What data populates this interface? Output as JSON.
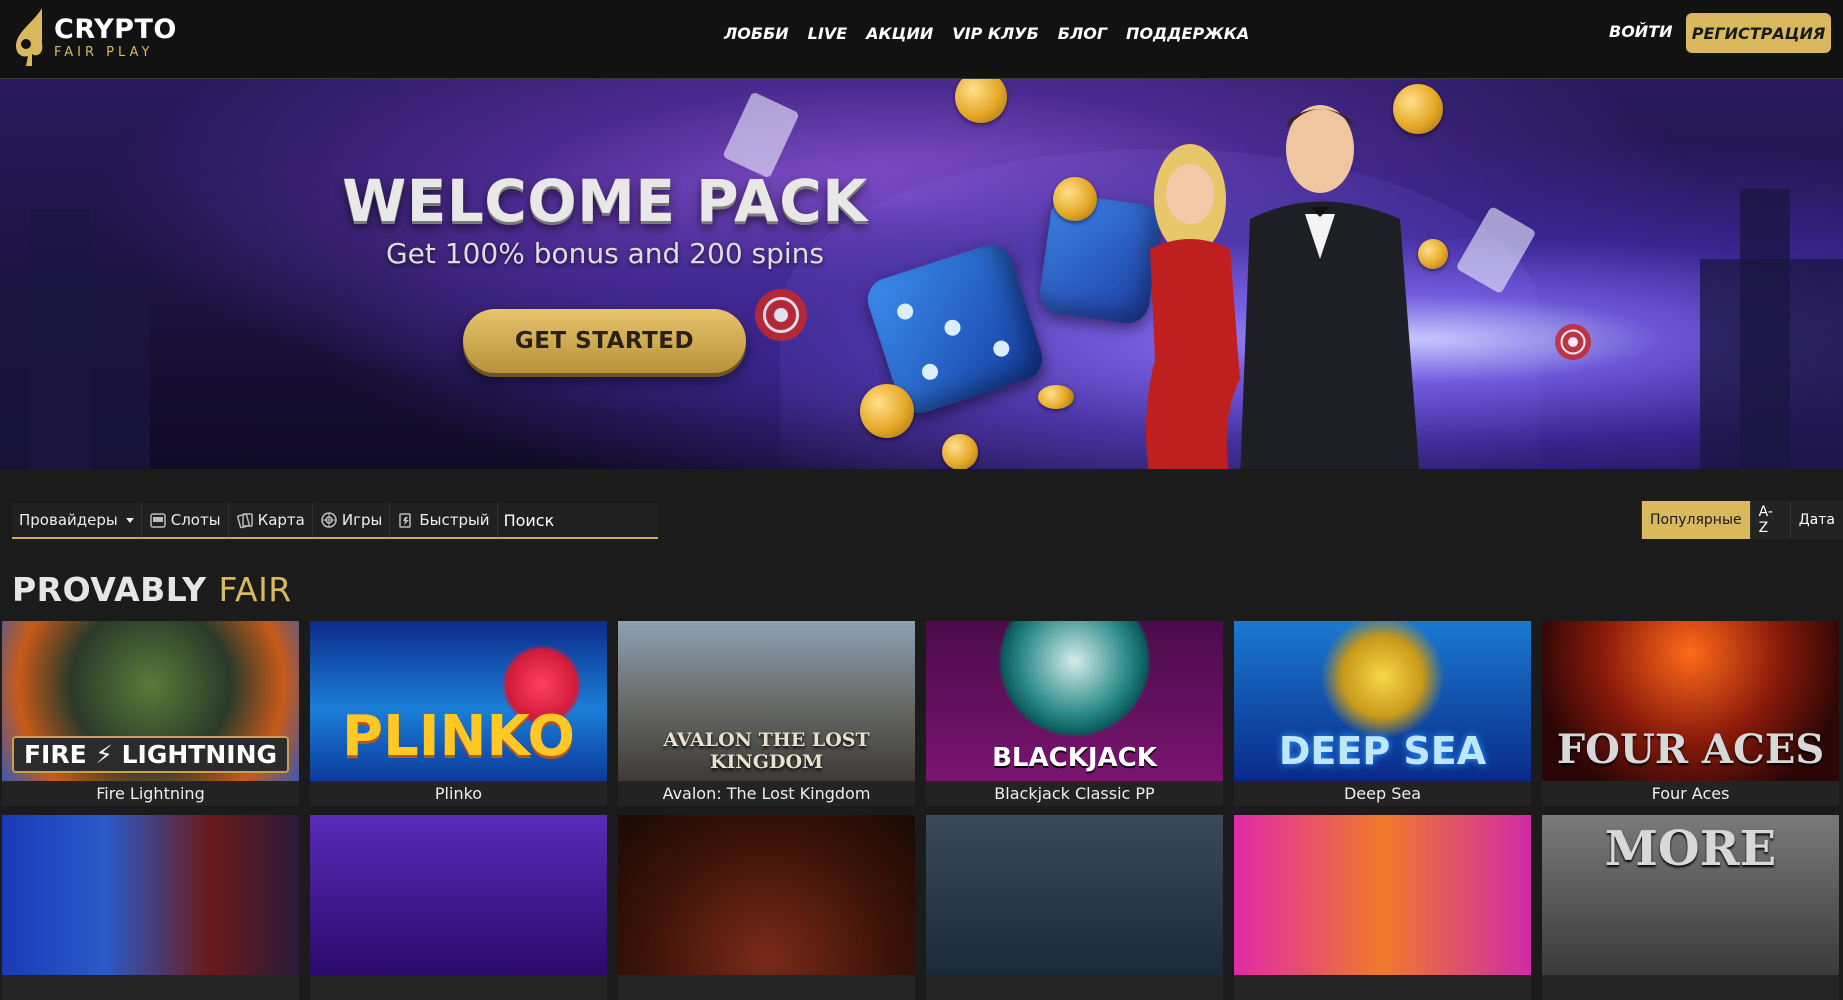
{
  "header": {
    "logo": {
      "line1": "CRYPTO",
      "line2": "FAIR PLAY"
    },
    "nav": [
      "ЛОББИ",
      "LIVE",
      "АКЦИИ",
      "VIP КЛУБ",
      "БЛОГ",
      "ПОДДЕРЖКА"
    ],
    "login_label": "ВОЙТИ",
    "register_label": "РЕГИСТРАЦИЯ"
  },
  "hero": {
    "title": "WELCOME PACK",
    "subtitle": "Get 100% bonus and 200 spins",
    "cta_label": "GET STARTED"
  },
  "filters": {
    "providers_label": "Провайдеры",
    "slots_label": "Слоты",
    "cards_label": "Карта",
    "games_label": "Игры",
    "fast_label": "Быстрый",
    "search_placeholder": "Поиск"
  },
  "sort": {
    "options": [
      "Популярные",
      "A-Z",
      "Дата"
    ],
    "active": "Популярные"
  },
  "section": {
    "title_white": "PROVABLY",
    "title_gold": "FAIR"
  },
  "games": [
    {
      "name": "Fire Lightning",
      "logo": "FIRE ⚡ LIGHTNING"
    },
    {
      "name": "Plinko",
      "logo": "PLINKO"
    },
    {
      "name": "Avalon: The Lost Kingdom",
      "logo": "AVALON THE LOST KINGDOM"
    },
    {
      "name": "Blackjack Classic PP",
      "logo": "BLACKJACK"
    },
    {
      "name": "Deep Sea",
      "logo": "DEEP SEA"
    },
    {
      "name": "Four Aces",
      "logo": "FOUR ACES"
    }
  ],
  "games_row2": [
    {
      "name": "",
      "logo": ""
    },
    {
      "name": "",
      "logo": ""
    },
    {
      "name": "",
      "logo": ""
    },
    {
      "name": "",
      "logo": ""
    },
    {
      "name": "",
      "logo": ""
    },
    {
      "name": "",
      "logo": "MORE"
    }
  ],
  "colors": {
    "accent_gold": "#d9b85e",
    "header_bg": "#121212",
    "page_bg": "#1b1b1b"
  }
}
